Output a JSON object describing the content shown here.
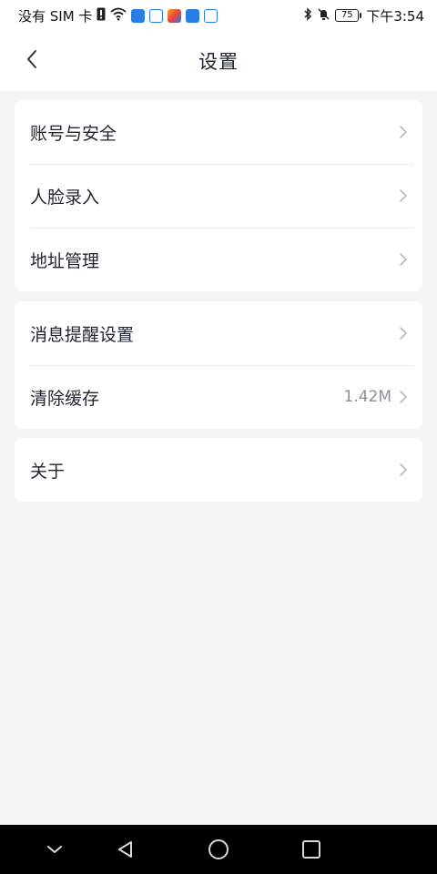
{
  "status_bar": {
    "carrier": "没有 SIM 卡",
    "battery": "75",
    "time": "下午3:54",
    "icons": [
      "sim-alert-icon",
      "wifi-icon",
      "app-notification-icon",
      "baidu-paw-icon",
      "app-colorful-icon",
      "cloud-app-icon",
      "baidu-paw-icon",
      "bluetooth-icon",
      "mute-bell-icon",
      "battery-icon"
    ],
    "colors": {
      "app_blue": "#2a7de1",
      "app_orange": "#f5a623",
      "app_red": "#e8453c"
    }
  },
  "header": {
    "title": "设置",
    "back_icon": "chevron-left-icon"
  },
  "groups": [
    {
      "items": [
        {
          "label": "账号与安全",
          "value": ""
        },
        {
          "label": "人脸录入",
          "value": ""
        },
        {
          "label": "地址管理",
          "value": ""
        }
      ]
    },
    {
      "items": [
        {
          "label": "消息提醒设置",
          "value": ""
        },
        {
          "label": "清除缓存",
          "value": "1.42M"
        }
      ]
    },
    {
      "items": [
        {
          "label": "关于",
          "value": ""
        }
      ]
    }
  ],
  "nav_bar": {
    "buttons": [
      "collapse-down-icon",
      "back-triangle-icon",
      "home-circle-icon",
      "recents-square-icon"
    ]
  }
}
